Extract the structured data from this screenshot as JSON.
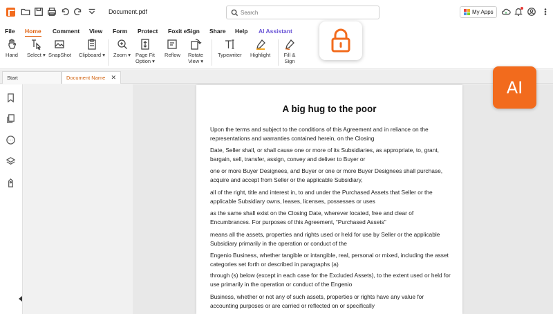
{
  "titlebar": {
    "filename": "Document.pdf",
    "search_placeholder": "Search",
    "my_apps_label": "My Apps",
    "quick_access_icons": [
      "open-folder-icon",
      "save-icon",
      "print-icon",
      "undo-icon",
      "redo-icon",
      "customize-dropdown-icon"
    ],
    "right_icons": [
      "cloud-sync-icon",
      "notification-bell-icon",
      "account-icon",
      "more-options-icon"
    ]
  },
  "menu": {
    "items": [
      "File",
      "Home",
      "Comment",
      "View",
      "Form",
      "Protect",
      "Foxit eSign",
      "Share",
      "Help",
      "AI Assistant"
    ],
    "active": "Home"
  },
  "ribbon": {
    "tools": [
      {
        "icon": "hand-icon",
        "label": "Hand"
      },
      {
        "icon": "select-cursor-icon",
        "label": "Select"
      },
      {
        "icon": "snapshot-icon",
        "label": "SnapShot"
      },
      {
        "icon": "clipboard-icon",
        "label": "Clipboard"
      },
      {
        "icon": "zoom-icon",
        "label": "Zoom"
      },
      {
        "icon": "page-fit-icon",
        "label": "Page Fit Option"
      },
      {
        "icon": "reflow-icon",
        "label": "Reflow"
      },
      {
        "icon": "rotate-view-icon",
        "label": "Rotate View"
      },
      {
        "icon": "typewriter-icon",
        "label": "Typewriter"
      },
      {
        "icon": "highlight-icon",
        "label": "Highlight"
      },
      {
        "icon": "fill-sign-icon",
        "label": "Fill & Sign"
      }
    ]
  },
  "tabs": [
    {
      "label": "Start"
    },
    {
      "label": "Document Name"
    }
  ],
  "document": {
    "title": "A big hug to the poor",
    "paragraphs": [
      "Upon the terms and subject to the conditions of this Agreement and in reliance on the representations and warranties contained herein, on the Closing",
      "Date, Seller shall, or shall cause one or more of its Subsidiaries, as appropriate, to, grant, bargain, sell, transfer, assign, convey and deliver to Buyer or",
      "one or more Buyer Designees, and Buyer or one or more Buyer Designees shall purchase, acquire and accept from Seller or the applicable Subsidiary,",
      "all of the right, title and interest in, to and under the Purchased Assets that Seller or the applicable Subsidiary owns, leases, licenses, possesses or uses",
      "as the same shall exist on the Closing Date, wherever located, free and clear of Encumbrances. For purposes of this Agreement, “Purchased Assets”",
      "means all the assets, properties and rights used or held for use by Seller or the applicable Subsidiary primarily in the operation or conduct of the",
      "Engenio Business, whether tangible or intangible, real, personal or mixed, including the asset categories set forth or described in paragraphs (a)",
      "through (s) below (except in each case for the Excluded Assets), to the extent used or held for use primarily in the operation or conduct of the Engenio",
      "Business, whether or not any of such assets, properties or rights have any value for accounting purposes or are carried or reflected on or specifically"
    ]
  },
  "overlays": {
    "lock_icon": "lock-icon",
    "ai_badge": "AI"
  },
  "colors": {
    "accent": "#f26b1d",
    "active_tab": "#d2620e",
    "ai_menu": "#6a55d6"
  }
}
